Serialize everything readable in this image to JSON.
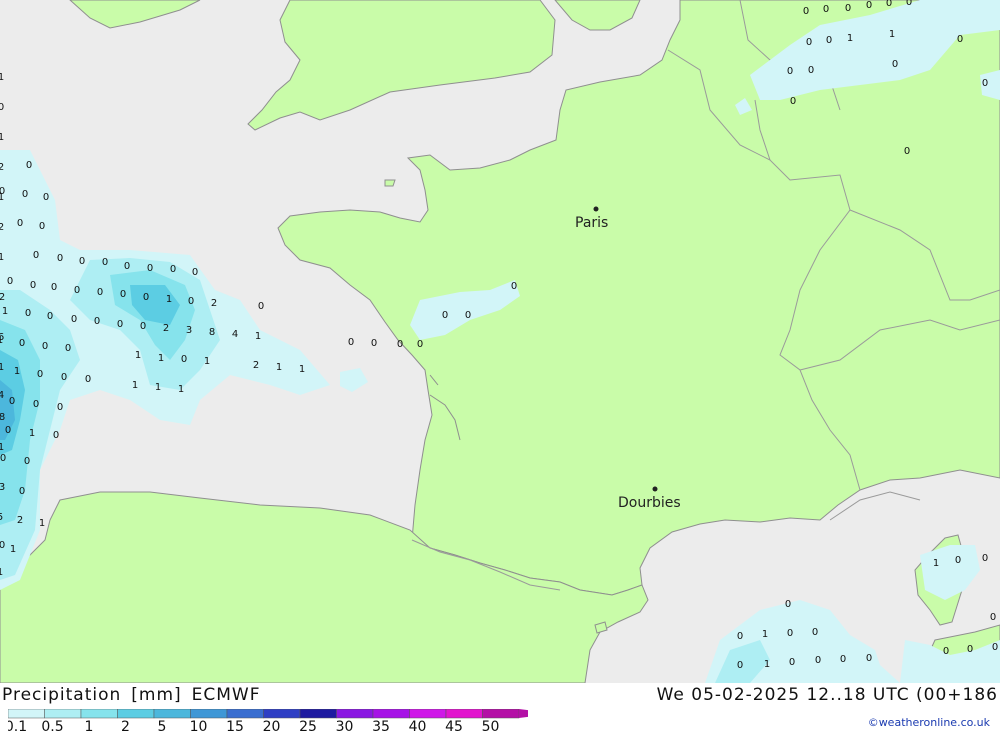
{
  "header": {
    "product": "Precipitation",
    "unit": "[mm]",
    "model": "ECMWF",
    "datetime": "We 05-02-2025 12..18 UTC (00+186"
  },
  "credit": "©weatheronline.co.uk",
  "colors": {
    "sea": "#ececec",
    "land": "#c9fca9",
    "border": "#8a8a8a"
  },
  "legend": {
    "labels": [
      "0.1",
      "0.5",
      "1",
      "2",
      "5",
      "10",
      "15",
      "20",
      "25",
      "30",
      "35",
      "40",
      "45",
      "50"
    ],
    "colors": [
      "#d2f5f8",
      "#aeeef3",
      "#86e3ec",
      "#5ccde3",
      "#4cb7dc",
      "#3f97d6",
      "#3a6ed0",
      "#2f3fc4",
      "#1e1aa0",
      "#8a18e2",
      "#a613e6",
      "#cf18e8",
      "#e215ce",
      "#b410a6"
    ]
  },
  "cities": [
    {
      "name": "Paris"
    },
    {
      "name": "Dourbies"
    }
  ],
  "values": {
    "north": [
      "0",
      "0",
      "0",
      "0",
      "0",
      "0",
      "0",
      "0",
      "1",
      "1",
      "0",
      "0",
      "0",
      "0",
      "0",
      "0",
      "0"
    ],
    "west": [
      "0",
      "0",
      "0",
      "0",
      "0",
      "0",
      "0",
      "0",
      "0",
      "0",
      "0",
      "0",
      "0",
      "0",
      "0",
      "0",
      "0",
      "0",
      "0",
      "0",
      "0",
      "1",
      "0",
      "2",
      "0",
      "0",
      "0",
      "0",
      "0",
      "0",
      "2",
      "3",
      "8",
      "4",
      "1",
      "1",
      "0",
      "1",
      "1",
      "0",
      "1",
      "2",
      "1",
      "1",
      "1",
      "1",
      "1",
      "0",
      "1",
      "0",
      "0",
      "0",
      "1",
      "0",
      "0",
      "0",
      "0",
      "0",
      "0",
      "1",
      "0",
      "0",
      "0",
      "0",
      "2",
      "1",
      "1",
      "1",
      "0",
      "5",
      "3",
      "1",
      "8",
      "4",
      "1",
      "6",
      "2",
      "1",
      "2",
      "1",
      "2",
      "1",
      "0",
      "1"
    ],
    "biscay": [
      "0",
      "0",
      "0",
      "0",
      "0",
      "0",
      "0"
    ],
    "south": [
      "0",
      "0",
      "1",
      "0",
      "0",
      "0",
      "1",
      "0",
      "0",
      "0",
      "0",
      "1",
      "0",
      "0",
      "0",
      "0",
      "0",
      "0"
    ]
  }
}
